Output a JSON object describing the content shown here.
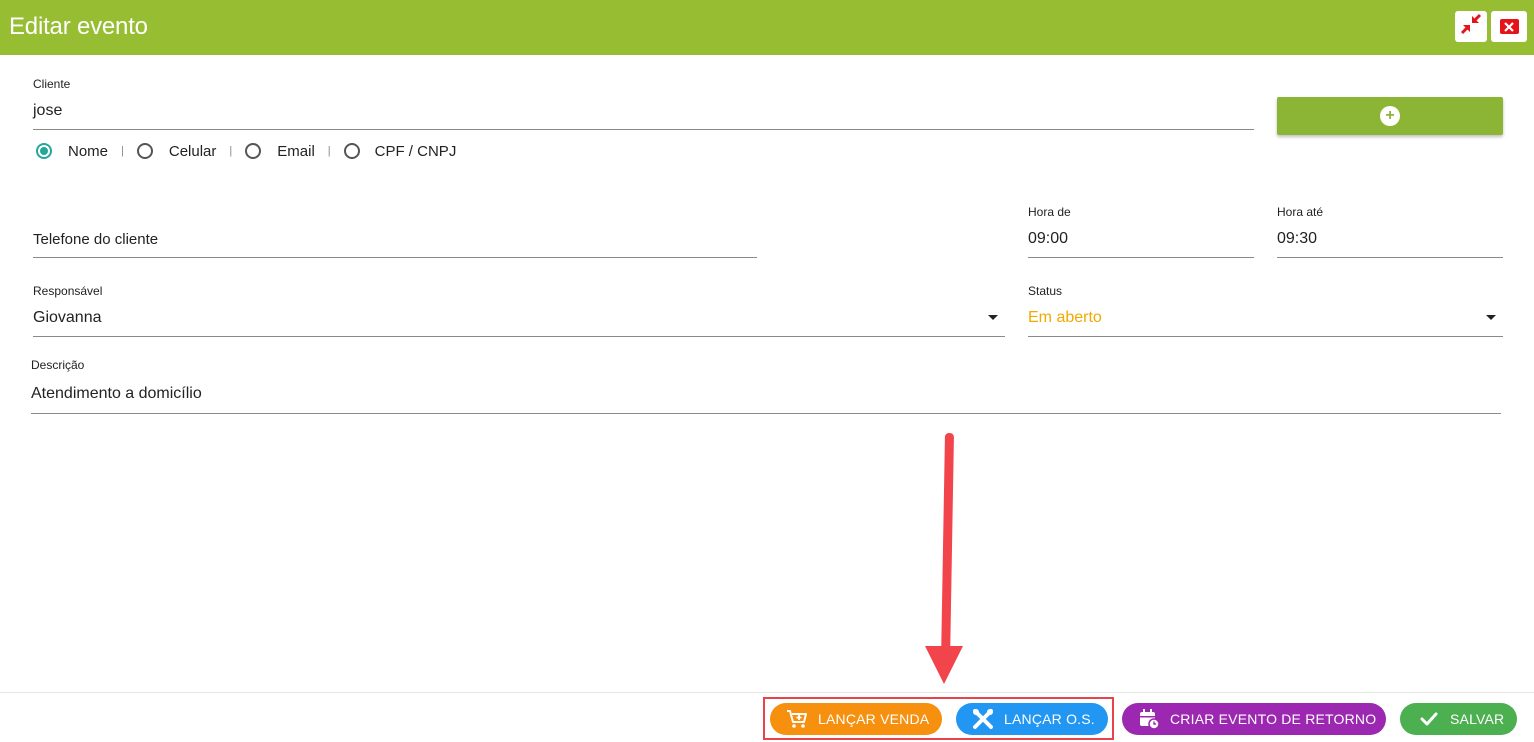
{
  "window": {
    "title": "Editar evento"
  },
  "colors": {
    "header": "#97bd33",
    "status_open": "#f2a900",
    "venda": "#f7900f",
    "os": "#2196f3",
    "retorno": "#9c27b0",
    "salvar": "#4caf50",
    "annotation": "#f2444b"
  },
  "cliente": {
    "label": "Cliente",
    "value": "jose",
    "search_by": [
      {
        "label": "Nome",
        "checked": true
      },
      {
        "label": "Celular",
        "checked": false
      },
      {
        "label": "Email",
        "checked": false
      },
      {
        "label": "CPF / CNPJ",
        "checked": false
      }
    ],
    "separator": "|",
    "add_icon": "plus-circle-icon"
  },
  "telefone": {
    "placeholder": "Telefone do cliente"
  },
  "hora_de": {
    "label": "Hora de",
    "value": "09:00"
  },
  "hora_ate": {
    "label": "Hora até",
    "value": "09:30"
  },
  "responsavel": {
    "label": "Responsável",
    "value": "Giovanna"
  },
  "status": {
    "label": "Status",
    "value": "Em aberto"
  },
  "descricao": {
    "label": "Descrição",
    "value": "Atendimento a domicílio"
  },
  "footer": {
    "venda": {
      "label": "LANÇAR VENDA",
      "icon": "cart-plus-icon"
    },
    "os": {
      "label": "LANÇAR O.S.",
      "icon": "tools-icon"
    },
    "retorno": {
      "label": "CRIAR EVENTO DE RETORNO",
      "icon": "calendar-clock-icon"
    },
    "salvar": {
      "label": "SALVAR",
      "icon": "check-icon"
    }
  }
}
